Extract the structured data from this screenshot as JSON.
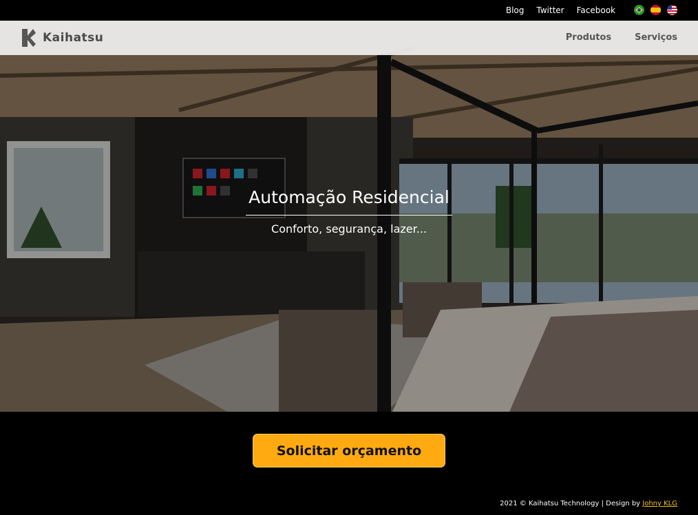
{
  "topbar": {
    "links": [
      "Blog",
      "Twitter",
      "Facebook"
    ],
    "flags": [
      "brazil-flag-icon",
      "spain-flag-icon",
      "usa-flag-icon"
    ]
  },
  "header": {
    "brand": "Kaihatsu",
    "nav": [
      "Produtos",
      "Serviços"
    ]
  },
  "hero": {
    "title": "Automação Residencial",
    "subtitle": "Conforto, segurança, lazer..."
  },
  "cta": {
    "label": "Solicitar orçamento"
  },
  "footer": {
    "text": "2021 © Kaihatsu Technology | Design by ",
    "author": "Johny KLG"
  },
  "colors": {
    "accent": "#ffaa11",
    "link": "#f5c518",
    "background": "#000000"
  }
}
